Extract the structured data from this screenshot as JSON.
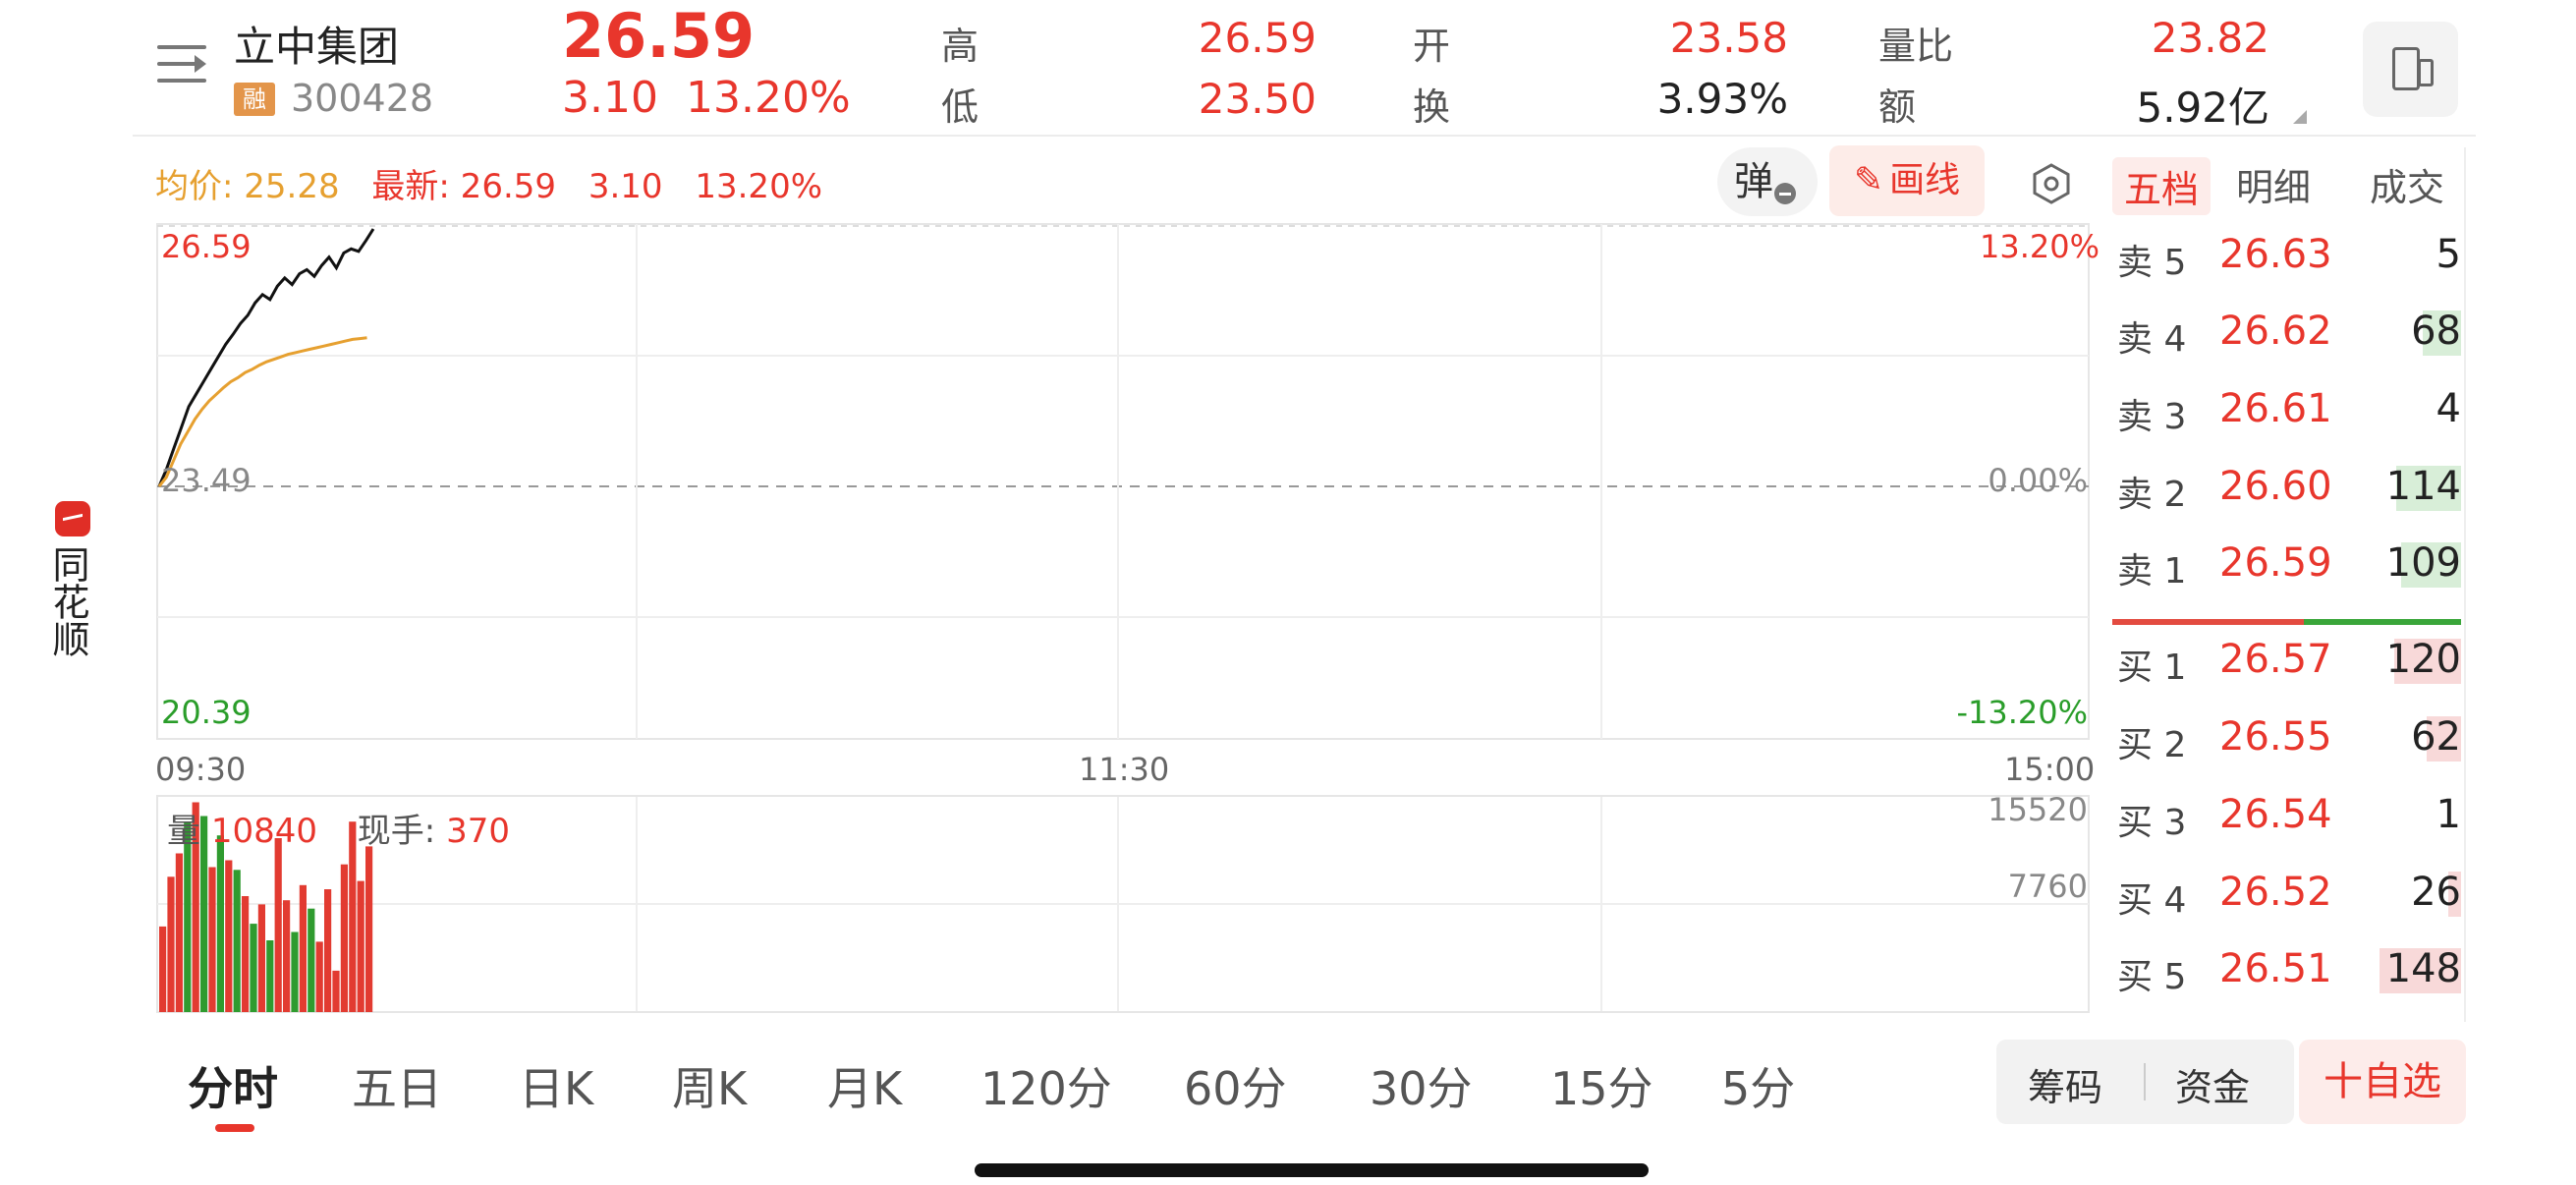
{
  "app": {
    "name": "同花顺"
  },
  "header": {
    "stock_name": "立中集团",
    "margin_badge": "融",
    "stock_code": "300428",
    "price": "26.59",
    "change": "3.10",
    "change_pct": "13.20%",
    "stats": [
      {
        "label": "高",
        "value": "26.59",
        "color": "#e8362c"
      },
      {
        "label": "低",
        "value": "23.50",
        "color": "#e8362c"
      },
      {
        "label": "开",
        "value": "23.58",
        "color": "#e8362c"
      },
      {
        "label": "换",
        "value": "3.93%",
        "color": "#222222"
      },
      {
        "label": "量比",
        "value": "23.82",
        "color": "#e8362c"
      },
      {
        "label": "额",
        "value": "5.92亿",
        "color": "#222222"
      }
    ],
    "icons": {
      "menu": "menu-icon",
      "device": "phone-switch-icon"
    }
  },
  "toolbar": {
    "avg_label": "均价: 25.28",
    "latest_label": "最新: 26.59",
    "latest_change": "3.10",
    "latest_pct": "13.20%",
    "danmaku_label": "弹",
    "draw_label": "画线",
    "settings_icon": "settings-hexagon-icon"
  },
  "chart_data": {
    "type": "line",
    "y_labels_left": {
      "top": "26.59",
      "mid": "23.49",
      "bottom": "20.39"
    },
    "y_labels_right": {
      "top": "13.20%",
      "mid": "0.00%",
      "bottom": "-13.20%"
    },
    "time_labels": [
      "09:30",
      "11:30",
      "15:00"
    ],
    "ylim": [
      20.39,
      26.59
    ],
    "prev_close": 23.49,
    "series": [
      {
        "role": "price",
        "color": "#111111",
        "values": [
          23.49,
          23.7,
          23.95,
          24.2,
          24.45,
          24.6,
          24.75,
          24.9,
          25.05,
          25.2,
          25.32,
          25.45,
          25.55,
          25.7,
          25.8,
          25.74,
          25.9,
          26.0,
          25.92,
          26.05,
          26.1,
          26.02,
          26.15,
          26.25,
          26.12,
          26.3,
          26.35,
          26.32,
          26.45,
          26.59
        ],
        "line_width": 3
      },
      {
        "role": "avg",
        "color": "#e6a030",
        "values": [
          23.49,
          23.6,
          23.8,
          24.0,
          24.15,
          24.3,
          24.42,
          24.52,
          24.6,
          24.68,
          24.75,
          24.8,
          24.86,
          24.9,
          24.95,
          24.99,
          25.02,
          25.05,
          25.08,
          25.1,
          25.12,
          25.14,
          25.16,
          25.18,
          25.2,
          25.22,
          25.24,
          25.26,
          25.27,
          25.28
        ],
        "line_width": 3
      }
    ],
    "volume": {
      "label": "量",
      "value": "10840",
      "current_label": "现手:",
      "current_value": "370",
      "max_label": "15520",
      "mid_label": "7760",
      "max": 15520,
      "bars": [
        {
          "v": 6200,
          "c": "r"
        },
        {
          "v": 9800,
          "c": "r"
        },
        {
          "v": 11500,
          "c": "r"
        },
        {
          "v": 13800,
          "c": "g"
        },
        {
          "v": 15200,
          "c": "r"
        },
        {
          "v": 14200,
          "c": "g"
        },
        {
          "v": 10500,
          "c": "r"
        },
        {
          "v": 12800,
          "c": "g"
        },
        {
          "v": 11000,
          "c": "r"
        },
        {
          "v": 10300,
          "c": "g"
        },
        {
          "v": 8400,
          "c": "r"
        },
        {
          "v": 6400,
          "c": "g"
        },
        {
          "v": 7800,
          "c": "r"
        },
        {
          "v": 5200,
          "c": "g"
        },
        {
          "v": 12600,
          "c": "r"
        },
        {
          "v": 8100,
          "c": "r"
        },
        {
          "v": 5800,
          "c": "g"
        },
        {
          "v": 9200,
          "c": "r"
        },
        {
          "v": 7500,
          "c": "g"
        },
        {
          "v": 5100,
          "c": "r"
        },
        {
          "v": 8900,
          "c": "r"
        },
        {
          "v": 3000,
          "c": "r"
        },
        {
          "v": 10700,
          "c": "r"
        },
        {
          "v": 13800,
          "c": "r"
        },
        {
          "v": 9500,
          "c": "r"
        },
        {
          "v": 12000,
          "c": "r"
        }
      ]
    },
    "red_color": "#e23b31",
    "green_color": "#2f9b2f"
  },
  "orderbook": {
    "tabs": [
      "五档",
      "明细",
      "成交"
    ],
    "asks": [
      {
        "label": "卖 5",
        "price": "26.63",
        "qty": "5",
        "bar": 0.0
      },
      {
        "label": "卖 4",
        "price": "26.62",
        "qty": "68",
        "bar": 0.35
      },
      {
        "label": "卖 3",
        "price": "26.61",
        "qty": "4",
        "bar": 0.0
      },
      {
        "label": "卖 2",
        "price": "26.60",
        "qty": "114",
        "bar": 0.6
      },
      {
        "label": "卖 1",
        "price": "26.59",
        "qty": "109",
        "bar": 0.55
      }
    ],
    "bids": [
      {
        "label": "买 1",
        "price": "26.57",
        "qty": "120",
        "bar": 0.62
      },
      {
        "label": "买 2",
        "price": "26.55",
        "qty": "62",
        "bar": 0.32
      },
      {
        "label": "买 3",
        "price": "26.54",
        "qty": "1",
        "bar": 0.0
      },
      {
        "label": "买 4",
        "price": "26.52",
        "qty": "26",
        "bar": 0.12
      },
      {
        "label": "买 5",
        "price": "26.51",
        "qty": "148",
        "bar": 0.75
      }
    ]
  },
  "bottom": {
    "periods": [
      "分时",
      "五日",
      "日K",
      "周K",
      "月K",
      "120分",
      "60分",
      "30分",
      "15分",
      "5分"
    ],
    "chip_label": "筹码",
    "funds_label": "资金",
    "add_watch_label": "十自选"
  }
}
